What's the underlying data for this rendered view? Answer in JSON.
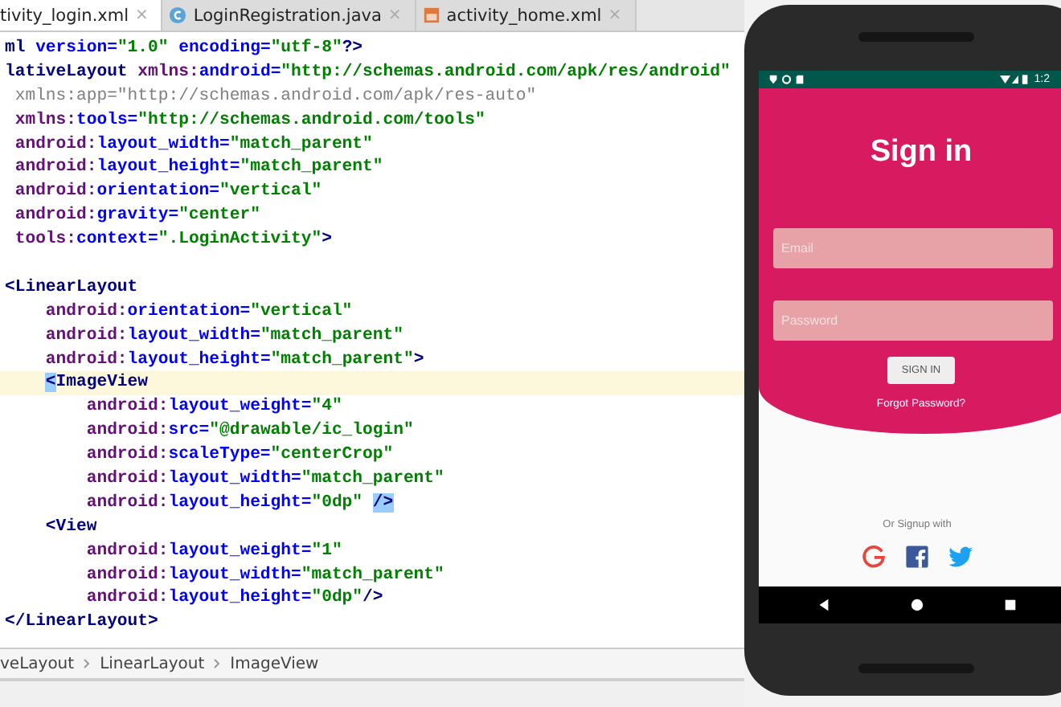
{
  "tabs": [
    {
      "label": "tivity_login.xml",
      "kind": "plain",
      "selected": true,
      "close": "×"
    },
    {
      "label": "LoginRegistration.java",
      "kind": "class",
      "selected": false,
      "close": "×"
    },
    {
      "label": "activity_home.xml",
      "kind": "layout",
      "selected": false,
      "close": "×"
    }
  ],
  "code_lines": [
    {
      "current": false,
      "tokens": [
        {
          "kind": "tag",
          "text": "ml "
        },
        {
          "kind": "attr",
          "text": "version="
        },
        {
          "kind": "value",
          "text": "\"1.0\" "
        },
        {
          "kind": "attr",
          "text": "encoding="
        },
        {
          "kind": "value",
          "text": "\"utf-8\""
        },
        {
          "kind": "tag",
          "text": "?>"
        }
      ]
    },
    {
      "current": false,
      "tokens": [
        {
          "kind": "tag",
          "text": "lativeLayout "
        },
        {
          "kind": "ns",
          "text": "xmlns:"
        },
        {
          "kind": "attr",
          "text": "android="
        },
        {
          "kind": "value",
          "text": "\"http://schemas.android.com/apk/res/android\""
        }
      ]
    },
    {
      "current": false,
      "tokens": [
        {
          "kind": "unused",
          "text": " xmlns:app=\"http://schemas.android.com/apk/res-auto\""
        }
      ]
    },
    {
      "current": false,
      "tokens": [
        {
          "kind": "ns",
          "text": " xmlns:"
        },
        {
          "kind": "attr",
          "text": "tools="
        },
        {
          "kind": "value",
          "text": "\"http://schemas.android.com/tools\""
        }
      ]
    },
    {
      "current": false,
      "tokens": [
        {
          "kind": "ns",
          "text": " android:"
        },
        {
          "kind": "attr",
          "text": "layout_width="
        },
        {
          "kind": "value",
          "text": "\"match_parent\""
        }
      ]
    },
    {
      "current": false,
      "tokens": [
        {
          "kind": "ns",
          "text": " android:"
        },
        {
          "kind": "attr",
          "text": "layout_height="
        },
        {
          "kind": "value",
          "text": "\"match_parent\""
        }
      ]
    },
    {
      "current": false,
      "tokens": [
        {
          "kind": "ns",
          "text": " android:"
        },
        {
          "kind": "attr",
          "text": "orientation="
        },
        {
          "kind": "value",
          "text": "\"vertical\""
        }
      ]
    },
    {
      "current": false,
      "tokens": [
        {
          "kind": "ns",
          "text": " android:"
        },
        {
          "kind": "attr",
          "text": "gravity="
        },
        {
          "kind": "value",
          "text": "\"center\""
        }
      ]
    },
    {
      "current": false,
      "tokens": [
        {
          "kind": "ns",
          "text": " tools:"
        },
        {
          "kind": "attr",
          "text": "context="
        },
        {
          "kind": "value",
          "text": "\".LoginActivity\""
        },
        {
          "kind": "tag",
          "text": ">"
        }
      ]
    },
    {
      "current": false
    },
    {
      "current": false,
      "tokens": [
        {
          "kind": "tag",
          "text": "<LinearLayout"
        }
      ]
    },
    {
      "current": false,
      "tokens": [
        {
          "kind": "ns",
          "text": "    android:"
        },
        {
          "kind": "attr",
          "text": "orientation="
        },
        {
          "kind": "value",
          "text": "\"vertical\""
        }
      ]
    },
    {
      "current": false,
      "tokens": [
        {
          "kind": "ns",
          "text": "    android:"
        },
        {
          "kind": "attr",
          "text": "layout_width="
        },
        {
          "kind": "value",
          "text": "\"match_parent\""
        }
      ]
    },
    {
      "current": false,
      "tokens": [
        {
          "kind": "ns",
          "text": "    android:"
        },
        {
          "kind": "attr",
          "text": "layout_height="
        },
        {
          "kind": "value",
          "text": "\"match_parent\""
        },
        {
          "kind": "tag",
          "text": ">"
        }
      ]
    },
    {
      "current": true,
      "tokens": [
        {
          "kind": "indent"
        },
        {
          "kind": "match",
          "text": "<"
        },
        {
          "kind": "tag",
          "text": "ImageView"
        }
      ]
    },
    {
      "current": false,
      "tokens": [
        {
          "kind": "ns",
          "text": "        android:"
        },
        {
          "kind": "attr",
          "text": "layout_weight="
        },
        {
          "kind": "value",
          "text": "\"4\""
        }
      ]
    },
    {
      "current": false,
      "tokens": [
        {
          "kind": "ns",
          "text": "        android:"
        },
        {
          "kind": "attr",
          "text": "src="
        },
        {
          "kind": "value",
          "text": "\"@drawable/ic_login\""
        }
      ]
    },
    {
      "current": false,
      "tokens": [
        {
          "kind": "ns",
          "text": "        android:"
        },
        {
          "kind": "attr",
          "text": "scaleType="
        },
        {
          "kind": "value",
          "text": "\"centerCrop\""
        }
      ]
    },
    {
      "current": false,
      "tokens": [
        {
          "kind": "ns",
          "text": "        android:"
        },
        {
          "kind": "attr",
          "text": "layout_width="
        },
        {
          "kind": "value",
          "text": "\"match_parent\""
        }
      ]
    },
    {
      "current": false,
      "tokens": [
        {
          "kind": "ns",
          "text": "        android:"
        },
        {
          "kind": "attr",
          "text": "layout_height="
        },
        {
          "kind": "value",
          "text": "\"0dp\" "
        },
        {
          "kind": "match",
          "text": "/>"
        }
      ]
    },
    {
      "current": false,
      "tokens": [
        {
          "kind": "tag",
          "text": "    <View"
        }
      ]
    },
    {
      "current": false,
      "tokens": [
        {
          "kind": "ns",
          "text": "        android:"
        },
        {
          "kind": "attr",
          "text": "layout_weight="
        },
        {
          "kind": "value",
          "text": "\"1\""
        }
      ]
    },
    {
      "current": false,
      "tokens": [
        {
          "kind": "ns",
          "text": "        android:"
        },
        {
          "kind": "attr",
          "text": "layout_width="
        },
        {
          "kind": "value",
          "text": "\"match_parent\""
        }
      ]
    },
    {
      "current": false,
      "tokens": [
        {
          "kind": "ns",
          "text": "        android:"
        },
        {
          "kind": "attr",
          "text": "layout_height="
        },
        {
          "kind": "value",
          "text": "\"0dp\""
        },
        {
          "kind": "tag",
          "text": "/>"
        }
      ]
    },
    {
      "current": false,
      "tokens": [
        {
          "kind": "tag",
          "text": "</LinearLayout>"
        }
      ]
    }
  ],
  "breadcrumb": [
    "veLayout",
    "LinearLayout",
    "ImageView"
  ],
  "phone": {
    "status_time": "1:2",
    "title": "Sign in",
    "email": {
      "placeholder": "Email"
    },
    "password": {
      "placeholder": "Password"
    },
    "sign_in_button": "SIGN IN",
    "forgot_link": "Forgot Password?",
    "signup_label": "Or Signup with",
    "social": [
      {
        "kind": "google"
      },
      {
        "kind": "facebook"
      },
      {
        "kind": "twitter"
      }
    ]
  }
}
